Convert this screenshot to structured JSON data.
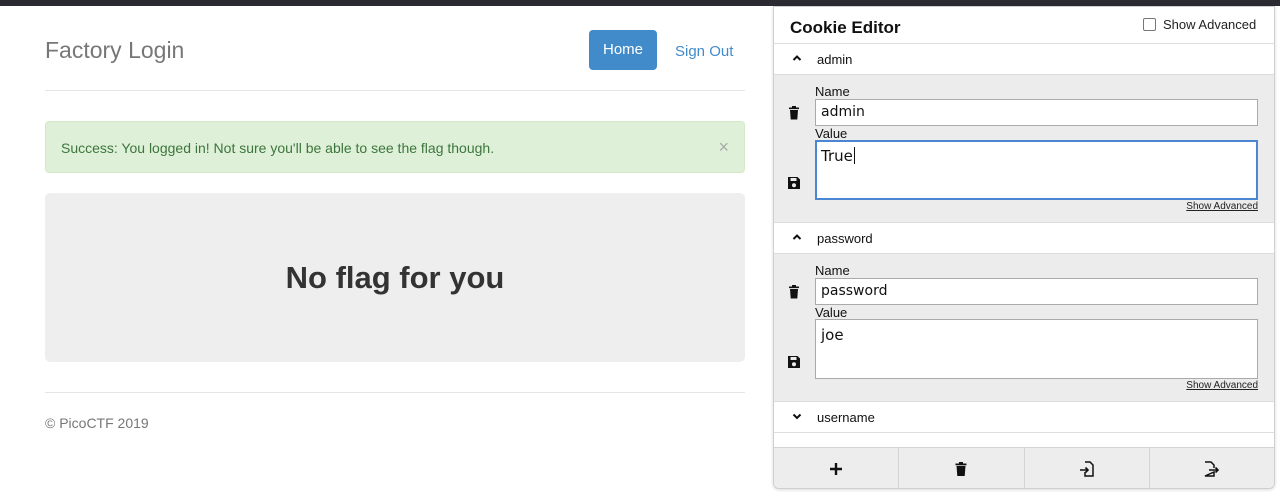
{
  "page": {
    "brand": "Factory Login",
    "nav": {
      "home": "Home",
      "sign_out": "Sign Out"
    },
    "alert": {
      "message": "Success: You logged in! Not sure you'll be able to see the flag though.",
      "close": "×"
    },
    "jumbotron": "No flag for you",
    "footer": "© PicoCTF 2019"
  },
  "cookie_editor": {
    "title": "Cookie Editor",
    "show_advanced_label": "Show Advanced",
    "show_advanced_checked": false,
    "cookies": [
      {
        "header": "admin",
        "name_label": "Name",
        "name": "admin",
        "value_label": "Value",
        "value": "True",
        "expanded": true,
        "advanced_link": "Show Advanced"
      },
      {
        "header": "password",
        "name_label": "Name",
        "name": "password",
        "value_label": "Value",
        "value": "joe",
        "expanded": true,
        "advanced_link": "Show Advanced"
      },
      {
        "header": "username",
        "expanded": false
      }
    ],
    "toolbar": [
      "add-icon",
      "delete-all-icon",
      "import-icon",
      "export-icon"
    ]
  },
  "colors": {
    "primary": "#428bca",
    "alert_bg": "#dff0d8",
    "alert_text": "#3c763d",
    "focus": "#4a86d1"
  }
}
